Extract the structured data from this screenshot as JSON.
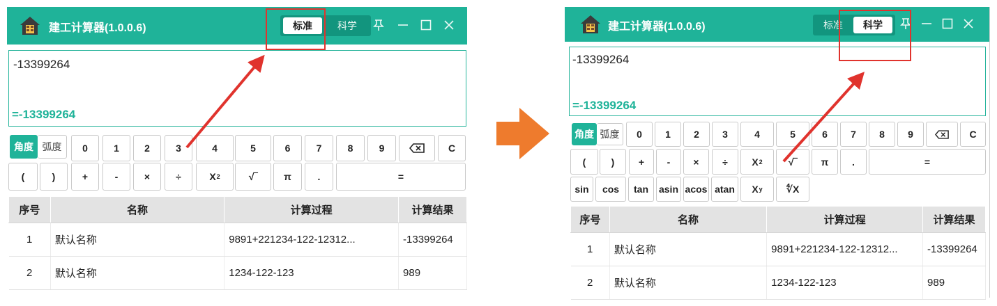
{
  "app": {
    "title": "建工计算器(1.0.0.6)"
  },
  "modes": {
    "standard": "标准",
    "science": "科学"
  },
  "window_controls": {
    "pin": "⚲",
    "minimize": "—",
    "maximize": "☐",
    "close": "✕"
  },
  "display": {
    "expression": "-13399264",
    "result": "=-13399264"
  },
  "angle_modes": {
    "degree": "角度",
    "radian": "弧度"
  },
  "keys": {
    "digits": [
      "0",
      "1",
      "2",
      "3",
      "4",
      "5",
      "6",
      "7",
      "8",
      "9"
    ],
    "backspace": "⌫",
    "clear": "C",
    "lparen": "(",
    "rparen": ")",
    "plus": "+",
    "minus": "-",
    "multiply": "×",
    "divide": "÷",
    "square": "X",
    "square_sup": "2",
    "sqrt": "√‾",
    "pi": "π",
    "dot": ".",
    "equals": "=",
    "sin": "sin",
    "cos": "cos",
    "tan": "tan",
    "asin": "asin",
    "acos": "acos",
    "atan": "atan",
    "power": "X",
    "power_sup": "y",
    "root": "∜X"
  },
  "history": {
    "headers": [
      "序号",
      "名称",
      "计算过程",
      "计算结果"
    ],
    "rows": [
      {
        "no": "1",
        "name": "默认名称",
        "process": "9891+221234-122-12312...",
        "result": "-13399264"
      },
      {
        "no": "2",
        "name": "默认名称",
        "process": "1234-122-123",
        "result": "989"
      }
    ]
  },
  "colors": {
    "accent": "#1fb399",
    "accent_dark": "#12957e",
    "annotation": "#e0332d",
    "arrow": "#ee7b2d"
  }
}
